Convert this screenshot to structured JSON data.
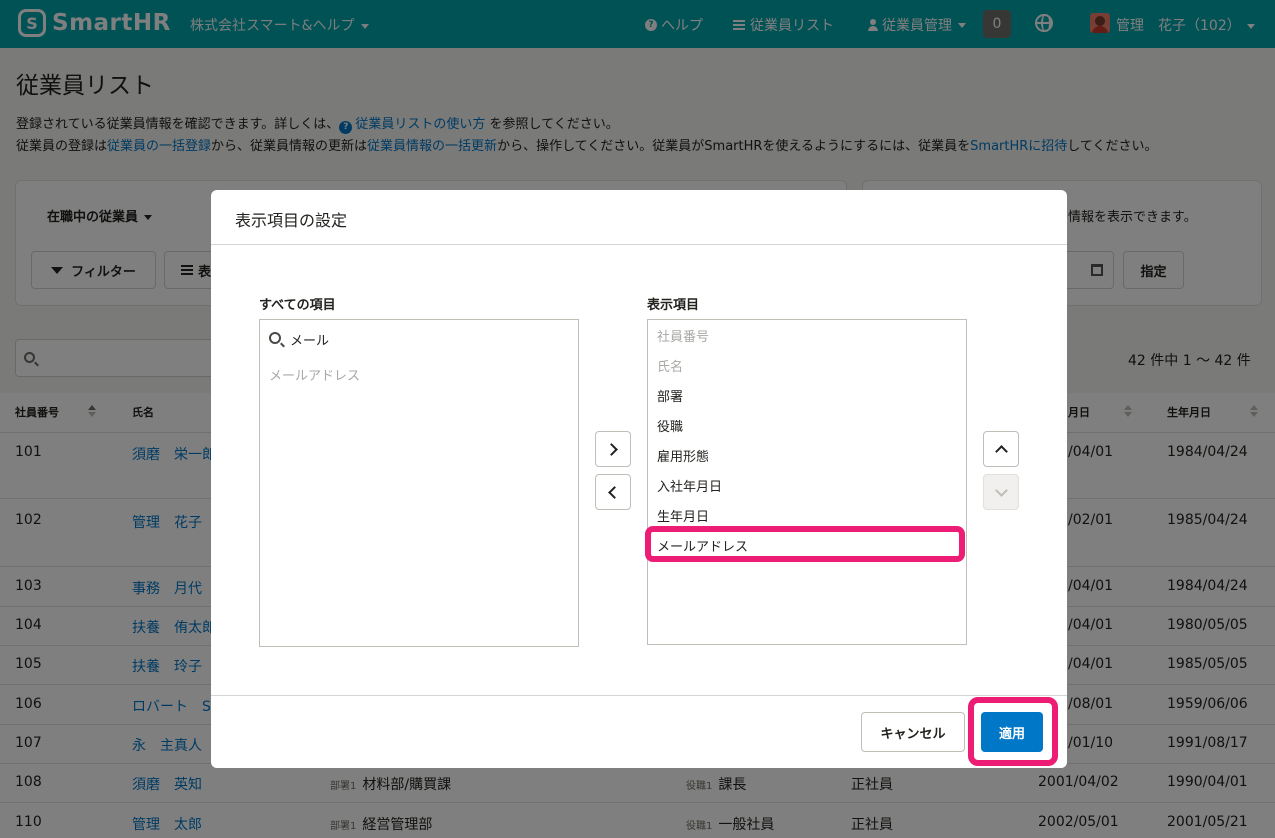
{
  "header": {
    "logo_text": "SmartHR",
    "company": "株式会社スマート&ヘルプ",
    "nav": {
      "help": "ヘルプ",
      "employee_list": "従業員リスト",
      "employee_mgmt": "従業員管理"
    },
    "notification_count": "0",
    "user": "管理　花子（102）"
  },
  "page": {
    "title": "従業員リスト",
    "desc_line1_pre": "登録されている従業員情報を確認できます。詳しくは、",
    "desc_line1_link": "従業員リストの使い方",
    "desc_line1_post": "を参照してください。",
    "desc_line2_a": "従業員の登録は",
    "desc_line2_link1": "従業員の一括登録",
    "desc_line2_b": "から、従業員情報の更新は",
    "desc_line2_link2": "従業員情報の一括更新",
    "desc_line2_c": "から、操作してください。従業員がSmartHRを使えるようにするには、従業員を",
    "desc_line2_link3": "SmartHRに招待",
    "desc_line2_d": "してください。",
    "status_select": "在職中の従業員",
    "filter_btn": "フィルター",
    "display_btn_partial": "表",
    "right_panel_text": "情報を表示できます。",
    "specify_btn": "指定",
    "count_text": "42 件中 1 〜 42 件"
  },
  "table": {
    "headers": {
      "emp_no": "社員番号",
      "name": "氏名",
      "hire_partial": "月日",
      "birth": "生年月日"
    },
    "rows": [
      {
        "no": "101",
        "name": "須磨　栄一郎",
        "hire": "/04/01",
        "birth": "1984/04/24"
      },
      {
        "no": "102",
        "name": "管理　花子",
        "hire": "/02/01",
        "birth": "1985/04/24"
      },
      {
        "no": "103",
        "name": "事務　月代",
        "hire": "/04/01",
        "birth": "1984/04/24"
      },
      {
        "no": "104",
        "name": "扶養　侑太郎",
        "hire": "/04/01",
        "birth": "1980/05/05"
      },
      {
        "no": "105",
        "name": "扶養　玲子",
        "hire": "/04/01",
        "birth": "1985/05/05"
      },
      {
        "no": "106",
        "name": "ロバート　S",
        "hire": "/08/01",
        "birth": "1959/06/06"
      },
      {
        "no": "107",
        "name": "永　主真人",
        "hire": "/01/10",
        "birth": "1991/08/17"
      },
      {
        "no": "108",
        "name": "須磨　英知",
        "dept_label": "部署1",
        "dept": "材料部/購買課",
        "role_label": "役職1",
        "role": "課長",
        "type": "正社員",
        "hire": "2001/04/02",
        "birth": "1990/04/01"
      },
      {
        "no": "110",
        "name": "管理　太郎",
        "dept_label": "部署1",
        "dept": "経営管理部",
        "role_label": "役職1",
        "role": "一般社員",
        "type": "正社員",
        "hire": "2002/05/01",
        "birth": "2001/05/21"
      }
    ]
  },
  "dialog": {
    "title": "表示項目の設定",
    "all_items_label": "すべての項目",
    "search_value": "メール",
    "all_items": [
      "メールアドレス"
    ],
    "display_items_label": "表示項目",
    "display_items": [
      {
        "label": "社員番号",
        "disabled": true
      },
      {
        "label": "氏名",
        "disabled": true
      },
      {
        "label": "部署",
        "disabled": false
      },
      {
        "label": "役職",
        "disabled": false
      },
      {
        "label": "雇用形態",
        "disabled": false
      },
      {
        "label": "入社年月日",
        "disabled": false
      },
      {
        "label": "生年月日",
        "disabled": false
      },
      {
        "label": "メールアドレス",
        "disabled": false,
        "highlighted": true
      }
    ],
    "cancel": "キャンセル",
    "apply": "適用"
  },
  "colors": {
    "header": "#00a5ab",
    "link": "#0077c7",
    "highlight": "#ed1c74"
  }
}
